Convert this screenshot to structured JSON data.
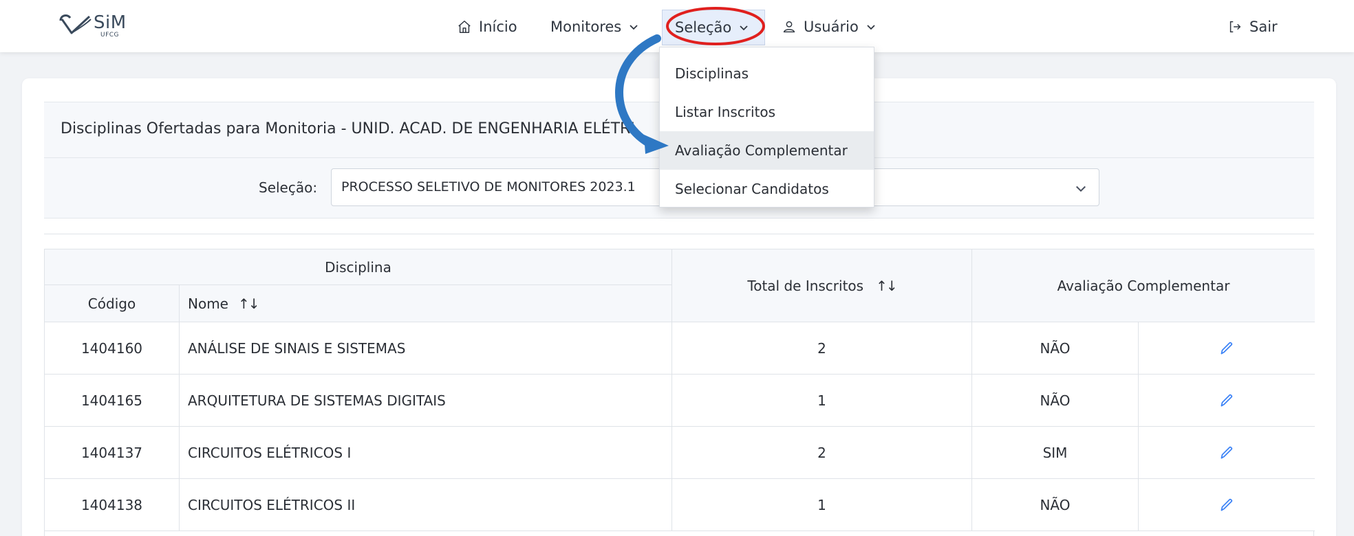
{
  "brand": {
    "logo_text": "SiM",
    "logo_sub": "UFCG"
  },
  "nav": {
    "inicio": "Início",
    "monitores": "Monitores",
    "selecao": "Seleção",
    "usuario": "Usuário",
    "sair": "Sair"
  },
  "menu": {
    "items": [
      {
        "label": "Disciplinas"
      },
      {
        "label": "Listar Inscritos"
      },
      {
        "label": "Avaliação Complementar"
      },
      {
        "label": "Selecionar Candidatos"
      }
    ],
    "active_index": 2
  },
  "panel": {
    "title": "Disciplinas Ofertadas para Monitoria - UNID. ACAD. DE ENGENHARIA ELÉTRI",
    "selection_label": "Seleção:",
    "selection_value": "PROCESSO SELETIVO DE MONITORES 2023.1"
  },
  "table": {
    "group_header": "Disciplina",
    "col_codigo": "Código",
    "col_nome": "Nome",
    "col_total": "Total de Inscritos",
    "col_avaliacao": "Avaliação Complementar",
    "sort_glyph": "↑↓",
    "rows": [
      {
        "codigo": "1404160",
        "nome": "ANÁLISE DE SINAIS E SISTEMAS",
        "total": "2",
        "avaliacao": "NÃO"
      },
      {
        "codigo": "1404165",
        "nome": "ARQUITETURA DE SISTEMAS DIGITAIS",
        "total": "1",
        "avaliacao": "NÃO"
      },
      {
        "codigo": "1404137",
        "nome": "CIRCUITOS ELÉTRICOS I",
        "total": "2",
        "avaliacao": "SIM"
      },
      {
        "codigo": "1404138",
        "nome": "CIRCUITOS ELÉTRICOS II",
        "total": "1",
        "avaliacao": "NÃO"
      }
    ]
  },
  "icons": {
    "home": "home-icon",
    "user": "user-icon",
    "logout": "logout-icon",
    "edit": "pencil-icon",
    "chevron": "chevron-down-icon"
  },
  "colors": {
    "accent": "#3b82f6",
    "annotation_circle": "#e0201e",
    "annotation_arrow": "#2e78c4",
    "page_bg": "#f1f3f6"
  }
}
